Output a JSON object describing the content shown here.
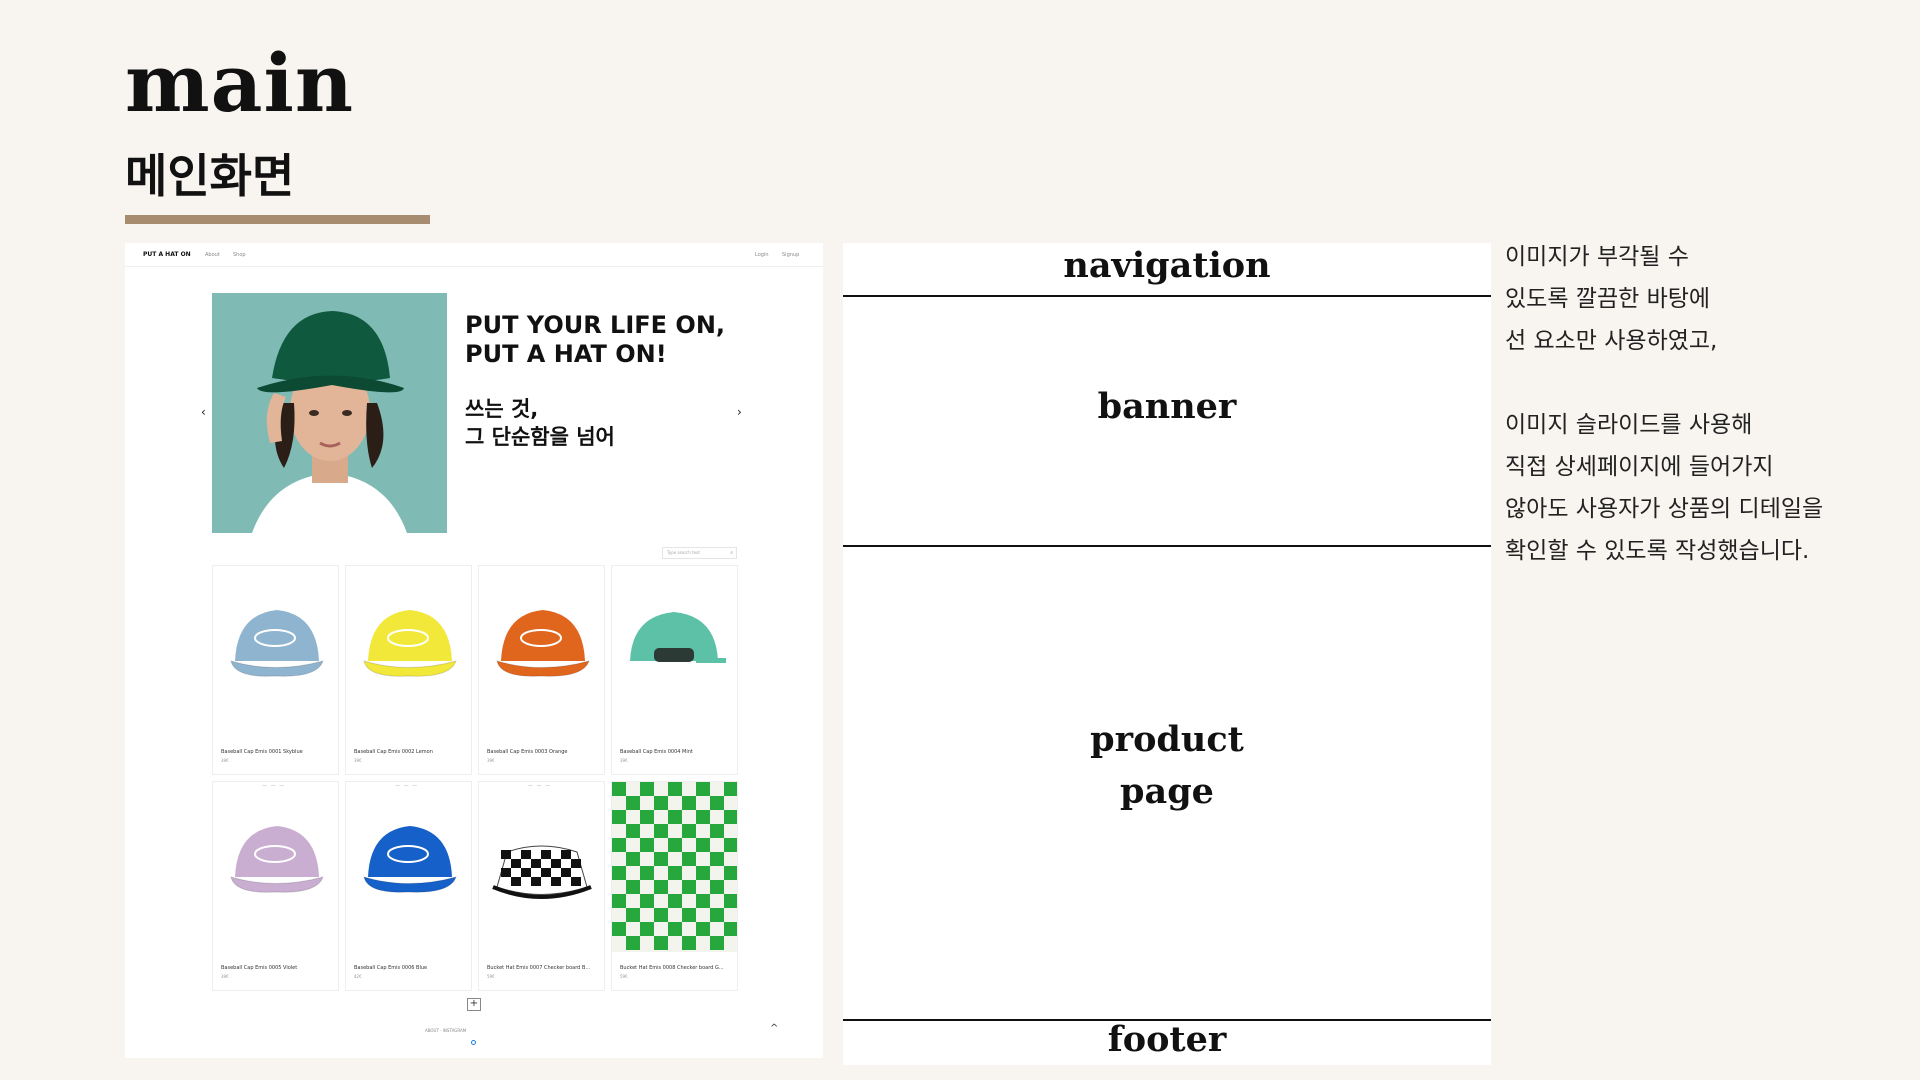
{
  "slide": {
    "title": "main",
    "subtitle": "메인화면",
    "accent_color": "#a88c6f"
  },
  "mock_site": {
    "brand": "PUT A HAT ON",
    "nav_links": [
      "About",
      "Shop"
    ],
    "nav_right_links": [
      "Login",
      "Signup"
    ],
    "banner": {
      "headline_line1": "PUT YOUR LIFE ON,",
      "headline_line2": "PUT A HAT ON!",
      "sub_line1": "쓰는 것,",
      "sub_line2": "그 단순함을 넘어",
      "prev_arrow": "‹",
      "next_arrow": "›"
    },
    "search_placeholder": "Type search text",
    "products": [
      {
        "name": "Baseball Cap Emis 0001 Skyblue",
        "price": "39€",
        "color": "#8fb4cf",
        "style": "cap",
        "icon": "cap-icon"
      },
      {
        "name": "Baseball Cap Emis 0002 Lemon",
        "price": "39€",
        "color": "#f2e83a",
        "style": "cap",
        "icon": "cap-icon"
      },
      {
        "name": "Baseball Cap Emis 0003 Orange",
        "price": "39€",
        "color": "#e0651d",
        "style": "cap",
        "icon": "cap-icon"
      },
      {
        "name": "Baseball Cap Emis 0004 Mint",
        "price": "39€",
        "color": "#5cc1a6",
        "style": "cap-back",
        "icon": "cap-icon"
      },
      {
        "name": "Baseball Cap Emis 0005 Violet",
        "price": "39€",
        "color": "#c9aed2",
        "style": "cap",
        "icon": "cap-icon"
      },
      {
        "name": "Baseball Cap Emis 0006 Blue",
        "price": "42€",
        "color": "#1560c9",
        "style": "cap",
        "icon": "cap-icon"
      },
      {
        "name": "Bucket Hat Emis 0007 Checker board B...",
        "price": "59€",
        "color": "#111111",
        "style": "bucket-check",
        "icon": "bucket-hat-icon"
      },
      {
        "name": "Bucket Hat Emis 0008 Checker board G...",
        "price": "59€",
        "color": "#27a83c",
        "style": "bucket-green",
        "icon": "bucket-hat-icon"
      }
    ],
    "more_button": "+",
    "top_arrow": "^",
    "footer_text": "ABOUT  ·  INSTAGRAM"
  },
  "structure": {
    "navigation": "navigation",
    "banner": "banner",
    "product_line1": "product",
    "product_line2": "page",
    "footer": "footer"
  },
  "description": {
    "lines_part1": [
      "이미지가 부각될 수",
      "있도록 깔끔한 바탕에",
      "선 요소만 사용하였고,"
    ],
    "lines_part2": [
      "이미지 슬라이드를 사용해",
      "직접 상세페이지에 들어가지",
      "않아도 사용자가 상품의 디테일을",
      "확인할 수 있도록 작성했습니다."
    ]
  }
}
